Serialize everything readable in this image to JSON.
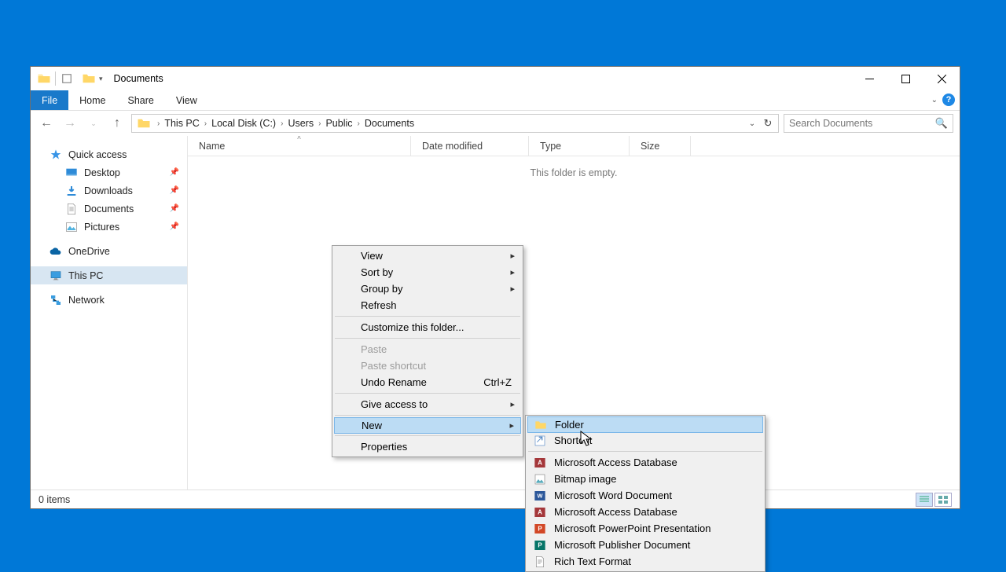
{
  "titlebar": {
    "title": "Documents"
  },
  "ribbon": {
    "file": "File",
    "home": "Home",
    "share": "Share",
    "view": "View"
  },
  "breadcrumbs": [
    "This PC",
    "Local Disk (C:)",
    "Users",
    "Public",
    "Documents"
  ],
  "search": {
    "placeholder": "Search Documents"
  },
  "nav": {
    "quick_access": "Quick access",
    "desktop": "Desktop",
    "downloads": "Downloads",
    "documents": "Documents",
    "pictures": "Pictures",
    "onedrive": "OneDrive",
    "this_pc": "This PC",
    "network": "Network"
  },
  "columns": {
    "name": "Name",
    "date": "Date modified",
    "type": "Type",
    "size": "Size"
  },
  "empty_msg": "This folder is empty.",
  "status": {
    "items": "0 items"
  },
  "ctx": {
    "view": "View",
    "sort_by": "Sort by",
    "group_by": "Group by",
    "refresh": "Refresh",
    "customize": "Customize this folder...",
    "paste": "Paste",
    "paste_shortcut": "Paste shortcut",
    "undo_rename": "Undo Rename",
    "undo_shortcut": "Ctrl+Z",
    "give_access": "Give access to",
    "new": "New",
    "properties": "Properties"
  },
  "new_submenu": {
    "folder": "Folder",
    "shortcut": "Shortcut",
    "access": "Microsoft Access Database",
    "bitmap": "Bitmap image",
    "word": "Microsoft Word Document",
    "access2": "Microsoft Access Database",
    "ppt": "Microsoft PowerPoint Presentation",
    "publisher": "Microsoft Publisher Document",
    "rtf": "Rich Text Format"
  }
}
